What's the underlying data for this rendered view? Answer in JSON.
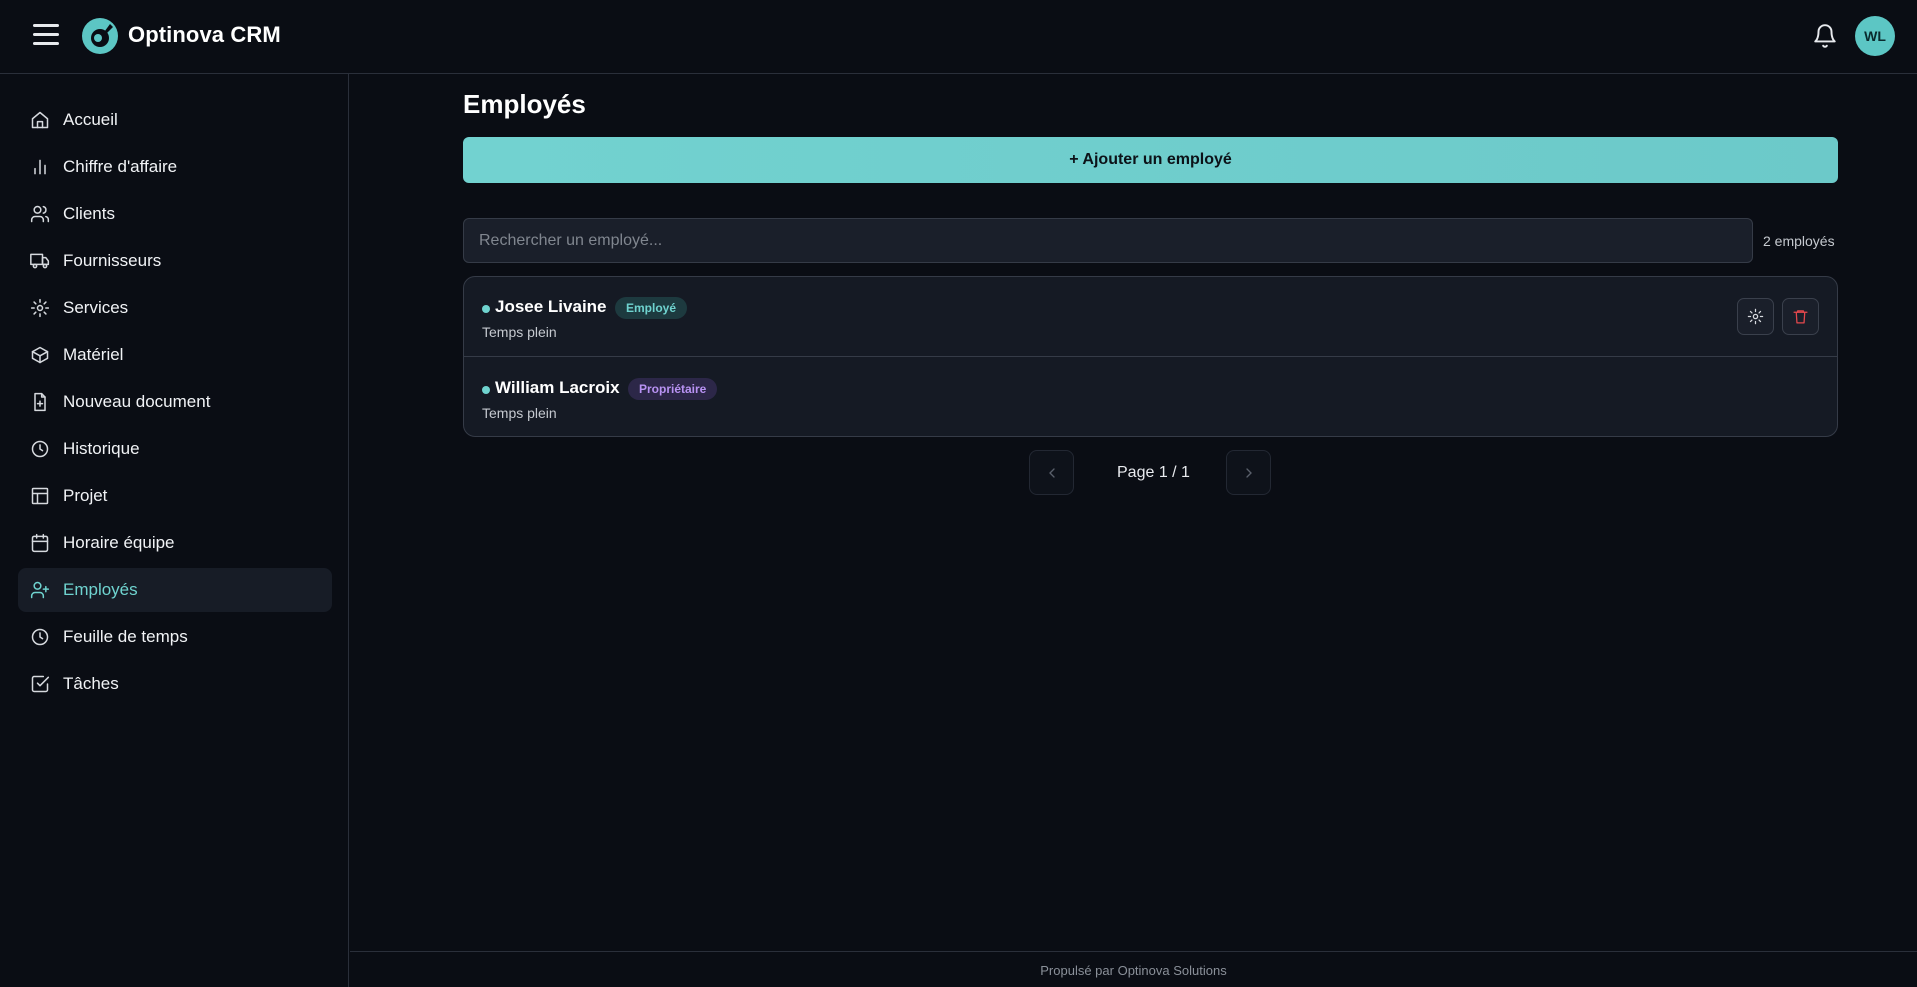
{
  "header": {
    "brand": "Optinova CRM",
    "avatar_initials": "WL"
  },
  "sidebar": {
    "items": [
      {
        "label": "Accueil",
        "icon": "home-icon"
      },
      {
        "label": "Chiffre d'affaire",
        "icon": "bar-chart-icon"
      },
      {
        "label": "Clients",
        "icon": "users-icon"
      },
      {
        "label": "Fournisseurs",
        "icon": "truck-icon"
      },
      {
        "label": "Services",
        "icon": "gear-icon"
      },
      {
        "label": "Matériel",
        "icon": "box-icon"
      },
      {
        "label": "Nouveau document",
        "icon": "file-plus-icon"
      },
      {
        "label": "Historique",
        "icon": "clock-icon"
      },
      {
        "label": "Projet",
        "icon": "layout-icon"
      },
      {
        "label": "Horaire équipe",
        "icon": "calendar-icon"
      },
      {
        "label": "Employés",
        "icon": "user-plus-icon",
        "active": true
      },
      {
        "label": "Feuille de temps",
        "icon": "clock-icon"
      },
      {
        "label": "Tâches",
        "icon": "check-square-icon"
      }
    ]
  },
  "main": {
    "title": "Employés",
    "add_button": "+ Ajouter un employé",
    "search_placeholder": "Rechercher un employé...",
    "count": "2 employés",
    "employees": [
      {
        "name": "Josee Livaine",
        "role": "Employé",
        "type": "Temps plein"
      },
      {
        "name": "William Lacroix",
        "role": "Propriétaire",
        "type": "Temps plein"
      }
    ],
    "pagination": "Page 1 / 1"
  },
  "footer": {
    "text": "Propulsé par Optinova Solutions"
  },
  "colors": {
    "accent": "#6fd3cf",
    "background": "#0a0d14",
    "owner_badge": "#b892f3",
    "danger": "#e5484d"
  }
}
